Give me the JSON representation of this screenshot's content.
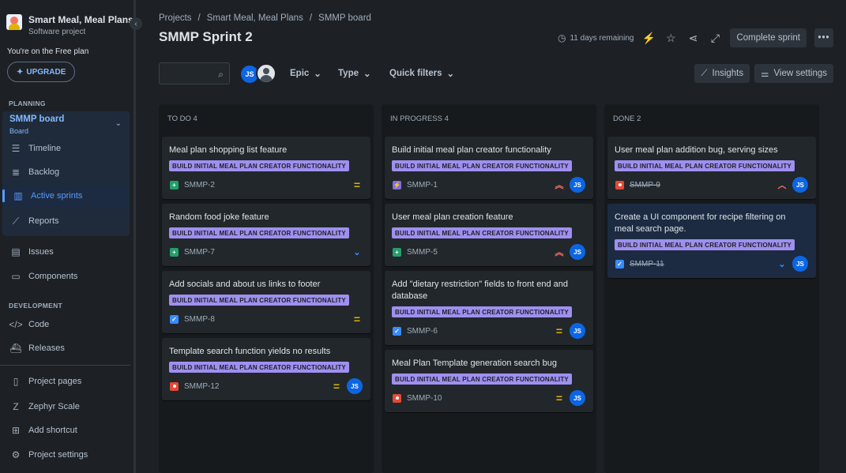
{
  "sidebar": {
    "project_name": "Smart Meal, Meal Plans",
    "project_type": "Software project",
    "free_plan": "You're on the Free plan",
    "upgrade": "UPGRADE",
    "planning_header": "PLANNING",
    "board_title": "SMMP board",
    "board_sub": "Board",
    "development_header": "DEVELOPMENT",
    "items": {
      "timeline": "Timeline",
      "backlog": "Backlog",
      "active_sprints": "Active sprints",
      "reports": "Reports",
      "issues": "Issues",
      "components": "Components",
      "code": "Code",
      "releases": "Releases",
      "project_pages": "Project pages",
      "zephyr": "Zephyr Scale",
      "add_shortcut": "Add shortcut",
      "project_settings": "Project settings"
    }
  },
  "header": {
    "breadcrumb": [
      "Projects",
      "/",
      "Smart Meal, Meal Plans",
      "/",
      "SMMP board"
    ],
    "title": "SMMP Sprint 2",
    "remaining": "11 days remaining",
    "complete_sprint": "Complete sprint"
  },
  "filters": {
    "search_placeholder": "",
    "avatar_initials": "JS",
    "epic": "Epic",
    "type": "Type",
    "quick_filters": "Quick filters",
    "insights": "Insights",
    "view_settings": "View settings"
  },
  "epic_label": "BUILD INITIAL MEAL PLAN CREATOR FUNCTIONALITY",
  "columns": {
    "todo": {
      "title": "TO DO 4",
      "cards": [
        {
          "title": "Meal plan shopping list feature",
          "key": "SMMP-2"
        },
        {
          "title": "Random food joke feature",
          "key": "SMMP-7"
        },
        {
          "title": "Add socials and about us links to footer",
          "key": "SMMP-8"
        },
        {
          "title": "Template search function yields no results",
          "key": "SMMP-12"
        }
      ]
    },
    "inprogress": {
      "title": "IN PROGRESS 4",
      "cards": [
        {
          "title": "Build initial meal plan creator functionality",
          "key": "SMMP-1"
        },
        {
          "title": "User meal plan creation feature",
          "key": "SMMP-5"
        },
        {
          "title": "Add \"dietary restriction\" fields to front end and database",
          "key": "SMMP-6"
        },
        {
          "title": "Meal Plan Template generation search bug",
          "key": "SMMP-10"
        }
      ]
    },
    "done": {
      "title": "DONE 2",
      "cards": [
        {
          "title": "User meal plan addition bug, serving sizes",
          "key": "SMMP-9"
        },
        {
          "title": "Create a UI component for recipe filtering on meal search page.",
          "key": "SMMP-11"
        }
      ]
    }
  }
}
